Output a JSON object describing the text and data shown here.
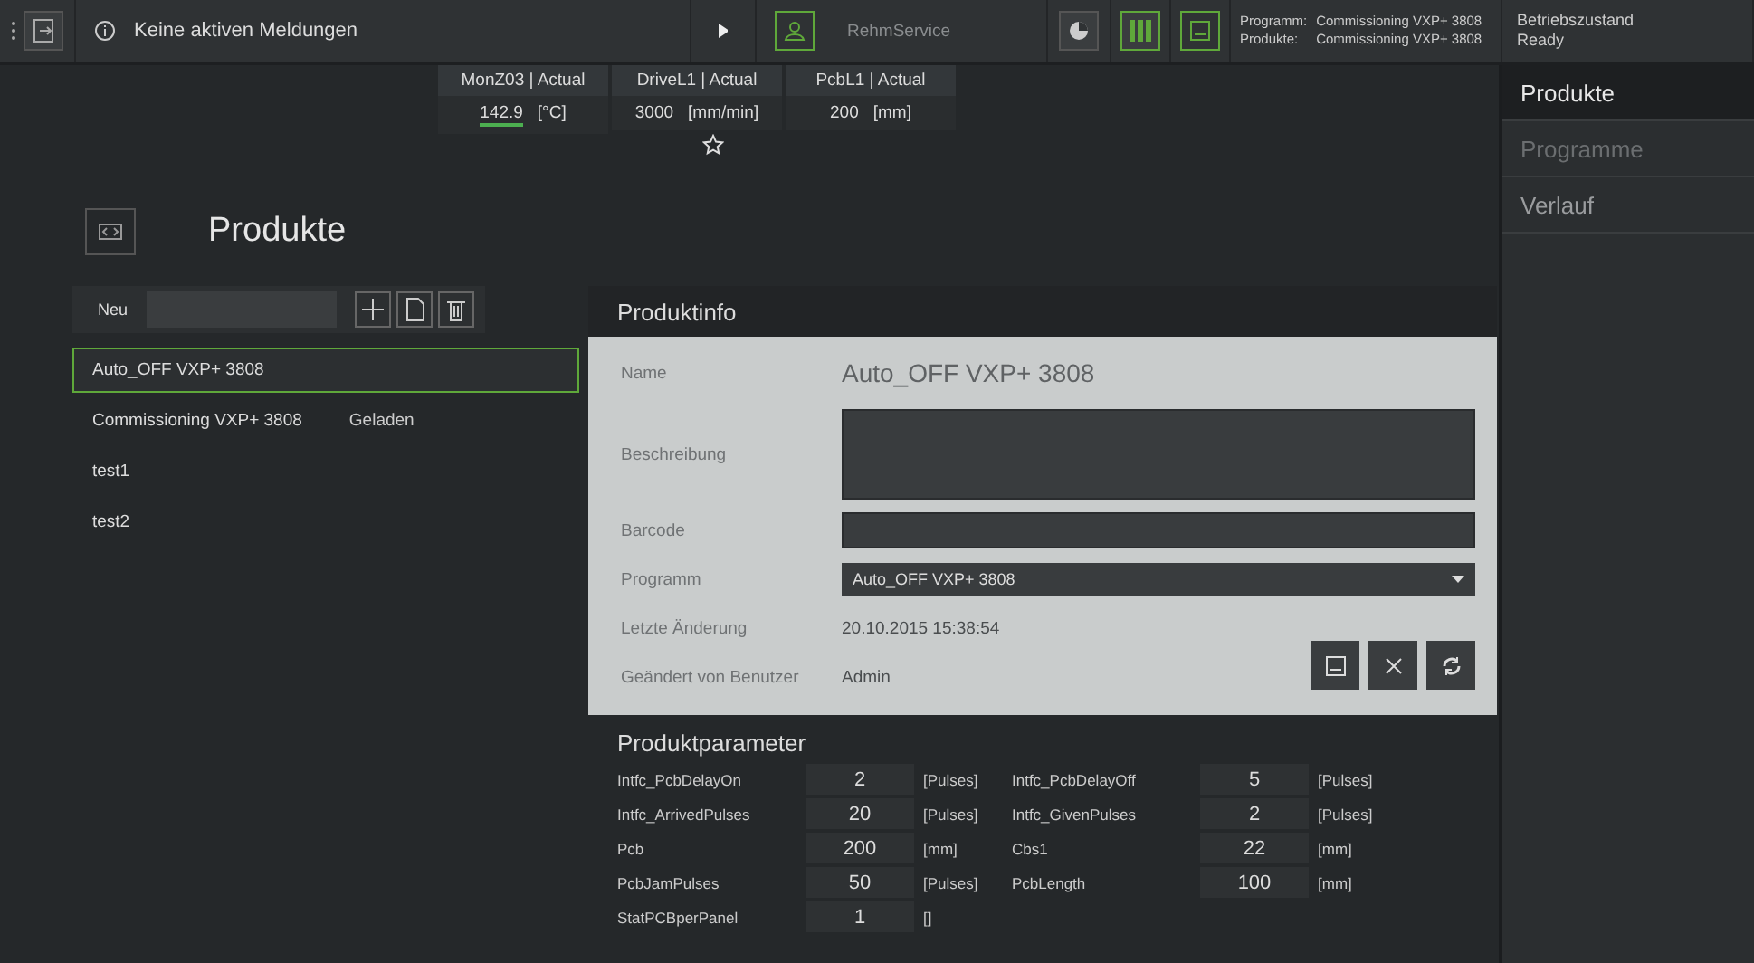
{
  "topbar": {
    "message": "Keine aktiven Meldungen",
    "user": "RehmService",
    "program_label": "Programm:",
    "program": "Commissioning VXP+ 3808",
    "product_label": "Produkte:",
    "product": "Commissioning VXP+ 3808",
    "state_label": "Betriebszustand",
    "state": "Ready"
  },
  "monitors": [
    {
      "title": "MonZ03 | Actual",
      "value": "142.9",
      "unit": "[°C]"
    },
    {
      "title": "DriveL1 | Actual",
      "value": "3000",
      "unit": "[mm/min]"
    },
    {
      "title": "PcbL1 | Actual",
      "value": "200",
      "unit": "[mm]"
    }
  ],
  "sidebar": {
    "items": [
      {
        "label": "Produkte",
        "selected": true,
        "disabled": false
      },
      {
        "label": "Programme",
        "selected": false,
        "disabled": true
      },
      {
        "label": "Verlauf",
        "selected": false,
        "disabled": false
      }
    ]
  },
  "products": {
    "title": "Produkte",
    "new_label": "Neu",
    "items": [
      {
        "name": "Auto_OFF VXP+ 3808",
        "selected": true
      },
      {
        "name": "Commissioning VXP+ 3808",
        "status": "Geladen",
        "selected": false
      },
      {
        "name": "test1",
        "selected": false
      },
      {
        "name": "test2",
        "selected": false
      }
    ]
  },
  "product_info": {
    "title": "Produktinfo",
    "fields": [
      {
        "kind": "text",
        "label": "Name",
        "value": "Auto_OFF VXP+ 3808"
      },
      {
        "kind": "textarea",
        "label": "Beschreibung"
      },
      {
        "kind": "input",
        "label": "Barcode"
      },
      {
        "kind": "select",
        "label": "Programm",
        "value": "Auto_OFF VXP+ 3808"
      },
      {
        "kind": "info",
        "label": "Letzte Änderung",
        "value": "20.10.2015 15:38:54"
      },
      {
        "kind": "info",
        "label": "Geändert von Benutzer",
        "value": "Admin"
      }
    ]
  },
  "parameters": {
    "title": "Produktparameter",
    "items": [
      {
        "name": "Intfc_PcbDelayOn",
        "value": "2",
        "unit": "[Pulses]"
      },
      {
        "name": "Intfc_PcbDelayOff",
        "value": "5",
        "unit": "[Pulses]"
      },
      {
        "name": "Intfc_ArrivedPulses",
        "value": "20",
        "unit": "[Pulses]"
      },
      {
        "name": "Intfc_GivenPulses",
        "value": "2",
        "unit": "[Pulses]"
      },
      {
        "name": "Pcb",
        "value": "200",
        "unit": "[mm]"
      },
      {
        "name": "Cbs1",
        "value": "22",
        "unit": "[mm]"
      },
      {
        "name": "PcbJamPulses",
        "value": "50",
        "unit": "[Pulses]"
      },
      {
        "name": "PcbLength",
        "value": "100",
        "unit": "[mm]"
      },
      {
        "name": "StatPCBperPanel",
        "value": "1",
        "unit": "[]"
      }
    ]
  }
}
